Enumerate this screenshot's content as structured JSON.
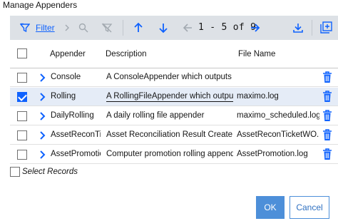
{
  "dialog": {
    "title": "Manage Appenders"
  },
  "toolbar": {
    "filter_label": "Filter",
    "page_range": "1 - 5 of 9",
    "icon_color": "#0f62fe",
    "disabled_color": "#a2a9b0"
  },
  "table": {
    "headers": {
      "appender": "Appender",
      "description": "Description",
      "file_name": "File Name"
    },
    "rows": [
      {
        "name": "Console",
        "description": "A ConsoleAppender which outputs to S",
        "file": "",
        "selected": false
      },
      {
        "name": "Rolling",
        "description": "A RollingFileAppender which outputs to",
        "file": "maximo.log",
        "selected": true
      },
      {
        "name": "DailyRolling",
        "description": "A daily rolling file appender",
        "file": "maximo_scheduled.log",
        "selected": false
      },
      {
        "name": "AssetReconTick",
        "description": "Asset Reconciliation Result Create Ticke",
        "file": "AssetReconTicketWO.log",
        "selected": false
      },
      {
        "name": "AssetPromotion",
        "description": "Computer promotion rolling appender",
        "file": "AssetPromotion.log",
        "selected": false
      }
    ]
  },
  "footer": {
    "select_records_label": "Select Records",
    "ok_label": "OK",
    "cancel_label": "Cancel"
  }
}
